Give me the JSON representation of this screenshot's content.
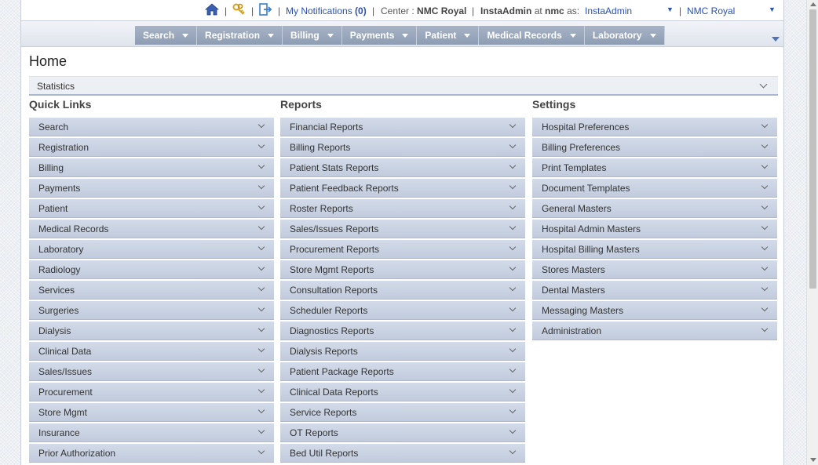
{
  "topbar": {
    "separators": [
      "|",
      "|",
      "|",
      "|",
      "|",
      "|"
    ],
    "notifications_label": "My Notifications",
    "notifications_count": "(0)",
    "center_label": "Center :",
    "center_value": "NMC Royal",
    "user": "InstaAdmin",
    "at_label": "at",
    "host": "nmc",
    "as_label": "as:",
    "role_select": "InstaAdmin",
    "center_select": "NMC Royal"
  },
  "nav": {
    "items": [
      {
        "label": "Search"
      },
      {
        "label": "Registration"
      },
      {
        "label": "Billing"
      },
      {
        "label": "Payments"
      },
      {
        "label": "Patient"
      },
      {
        "label": "Medical Records"
      },
      {
        "label": "Laboratory"
      }
    ]
  },
  "page": {
    "title": "Home",
    "statistics_label": "Statistics"
  },
  "quick_links": {
    "heading": "Quick Links",
    "items": [
      "Search",
      "Registration",
      "Billing",
      "Payments",
      "Patient",
      "Medical Records",
      "Laboratory",
      "Radiology",
      "Services",
      "Surgeries",
      "Dialysis",
      "Clinical Data",
      "Sales/Issues",
      "Procurement",
      "Store Mgmt",
      "Insurance",
      "Prior Authorization"
    ]
  },
  "reports": {
    "heading": "Reports",
    "items": [
      "Financial Reports",
      "Billing Reports",
      "Patient Stats Reports",
      "Patient Feedback Reports",
      "Roster Reports",
      "Sales/Issues Reports",
      "Procurement Reports",
      "Store Mgmt Reports",
      "Consultation Reports",
      "Scheduler Reports",
      "Diagnostics Reports",
      "Dialysis Reports",
      "Patient Package Reports",
      "Clinical Data Reports",
      "Service Reports",
      "OT Reports",
      "Bed Util Reports"
    ]
  },
  "settings": {
    "heading": "Settings",
    "items": [
      "Hospital Preferences",
      "Billing Preferences",
      "Print Templates",
      "Document Templates",
      "General Masters",
      "Hospital Admin Masters",
      "Hospital Billing Masters",
      "Stores Masters",
      "Dental Masters",
      "Messaging Masters",
      "Administration"
    ]
  },
  "icons": {
    "home": "home-icon",
    "keys": "keys-icon",
    "logout": "logout-icon",
    "chevron": "chevron-down-icon"
  },
  "colors": {
    "nav_bg": "#98a6bb",
    "item_bg": "#c9d2e3",
    "link": "#2b52a8"
  }
}
